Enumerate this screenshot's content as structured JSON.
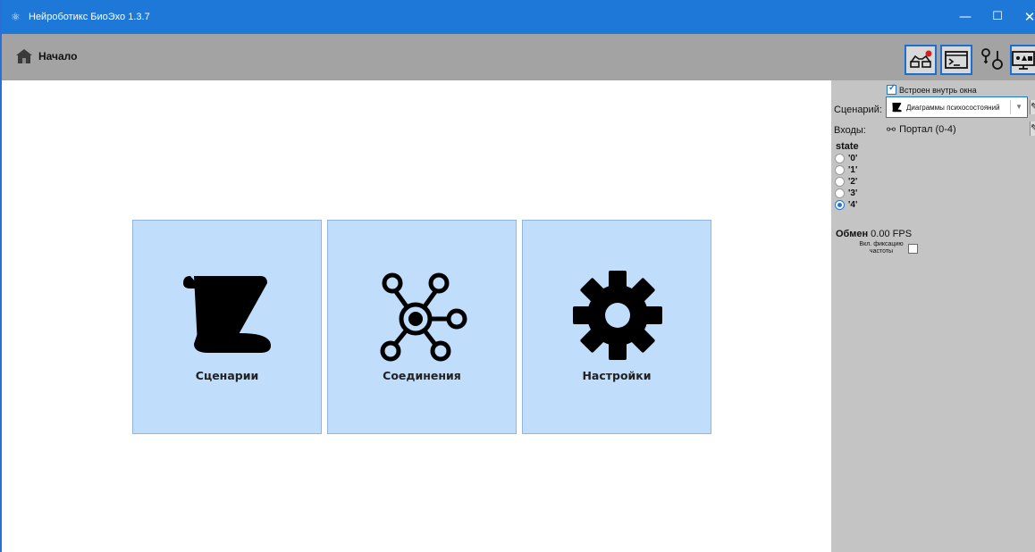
{
  "window": {
    "title": "Нейроботикс БиоЭхо 1.3.7",
    "app_icon": "app-logo-icon",
    "controls": {
      "minimize": "—",
      "maximize": "☐",
      "close": "✕"
    }
  },
  "toolbar": {
    "home_label": "Начало",
    "buttons": [
      {
        "name": "glasses-icon"
      },
      {
        "name": "console-icon"
      },
      {
        "name": "sensors-icon"
      },
      {
        "name": "display-icon"
      }
    ],
    "accent": "#1e78d7"
  },
  "tiles": [
    {
      "label": "Сценарии",
      "icon": "scroll-icon"
    },
    {
      "label": "Соединения",
      "icon": "network-icon"
    },
    {
      "label": "Настройки",
      "icon": "gear-icon"
    }
  ],
  "side": {
    "embed_label": "Встроен внутрь окна",
    "embed_checked": true,
    "scenario_label": "Сценарий:",
    "scenario_value": "Диаграммы психосостояний",
    "inputs_label": "Входы:",
    "inputs_value": "Портал (0-4)",
    "state_title": "state",
    "states": [
      {
        "label": "'0'",
        "selected": false
      },
      {
        "label": "'1'",
        "selected": false
      },
      {
        "label": "'2'",
        "selected": false
      },
      {
        "label": "'3'",
        "selected": false
      },
      {
        "label": "'4'",
        "selected": true
      }
    ],
    "exchange_label": "Обмен",
    "exchange_value": "0.00 FPS",
    "fix_label": "Вкл. фиксацию частоты",
    "fix_checked": false
  },
  "colors": {
    "titlebar": "#1e78d7",
    "toolbar": "#a3a3a3",
    "tile": "#c0ddfc",
    "side": "#c4c4c4"
  }
}
